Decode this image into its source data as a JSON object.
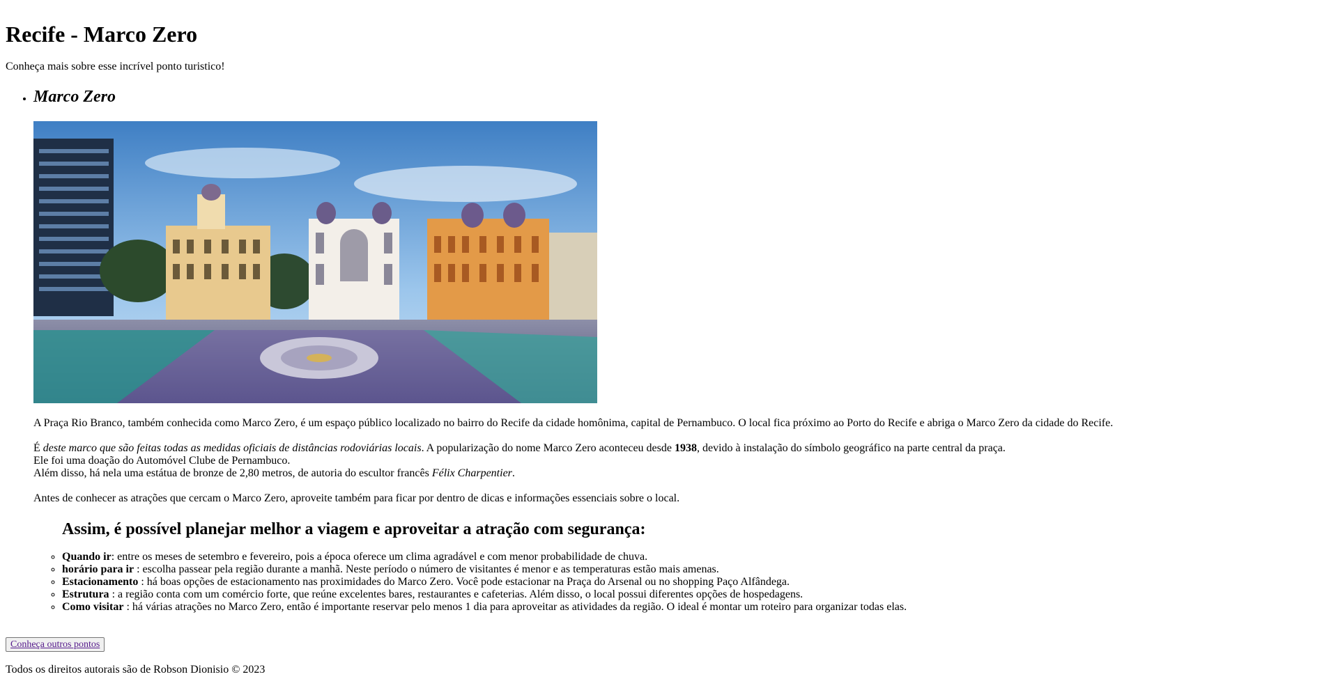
{
  "header": {
    "title": "Recife - Marco Zero",
    "subtitle": "Conheça mais sobre esse incrível ponto turistico!"
  },
  "section": {
    "heading": "Marco Zero",
    "paragraph1": "A Praça Rio Branco, também conhecida como Marco Zero, é um espaço público localizado no bairro do Recife da cidade homônima, capital de Pernambuco. O local fica próximo ao Porto do Recife e abriga o Marco Zero da cidade do Recife.",
    "paragraph2": {
      "prefix": "É ",
      "italic": "deste marco que são feitas todas as medidas oficiais de distâncias rodoviárias locais",
      "middle": ". A popularização do nome Marco Zero aconteceu desde ",
      "bold_year": "1938",
      "suffix": ", devido à instalação do símbolo geográfico na parte central da praça.",
      "line2": "Ele foi uma doação do Automóvel Clube de Pernambuco.",
      "line3_prefix": "Além disso, há nela uma estátua de bronze de 2,80 metros, de autoria do escultor francês ",
      "line3_italic": "Félix Charpentier",
      "line3_suffix": "."
    },
    "paragraph3": "Antes de conhecer as atrações que cercam o Marco Zero, aproveite também para ficar por dentro de dicas e informações essenciais sobre o local.",
    "tips_heading": "Assim, é possível planejar melhor a viagem e aproveitar a atração com segurança:",
    "tips": [
      {
        "term": "Quando ir",
        "text": ": entre os meses de setembro e fevereiro, pois a época oferece um clima agradável e com menor probabilidade de chuva."
      },
      {
        "term": "horário para ir",
        "text": " : escolha passear pela região durante a manhã. Neste período o número de visitantes é menor e as temperaturas estão mais amenas."
      },
      {
        "term": "Estacionamento",
        "text": " : há boas opções de estacionamento nas proximidades do Marco Zero. Você pode estacionar na Praça do Arsenal ou no shopping Paço Alfândega."
      },
      {
        "term": "Estrutura",
        "text": " : a região conta com um comércio forte, que reúne excelentes bares, restaurantes e cafeterias. Além disso, o local possui diferentes opções de hospedagens."
      },
      {
        "term": "Como visitar",
        "text": " : há várias atrações no Marco Zero, então é importante reservar pelo menos 1 dia para aproveitar as atividades da região. O ideal é montar um roteiro para organizar todas elas."
      }
    ]
  },
  "actions": {
    "more_button": "Conheça outros pontos"
  },
  "footer": {
    "copyright": "Todos os direitos autorais são de Robson Dionisio © 2023"
  },
  "colors": {
    "link": "#551a8b",
    "sky_top": "#4b8fd1",
    "sky_bottom": "#9bc3e8"
  }
}
